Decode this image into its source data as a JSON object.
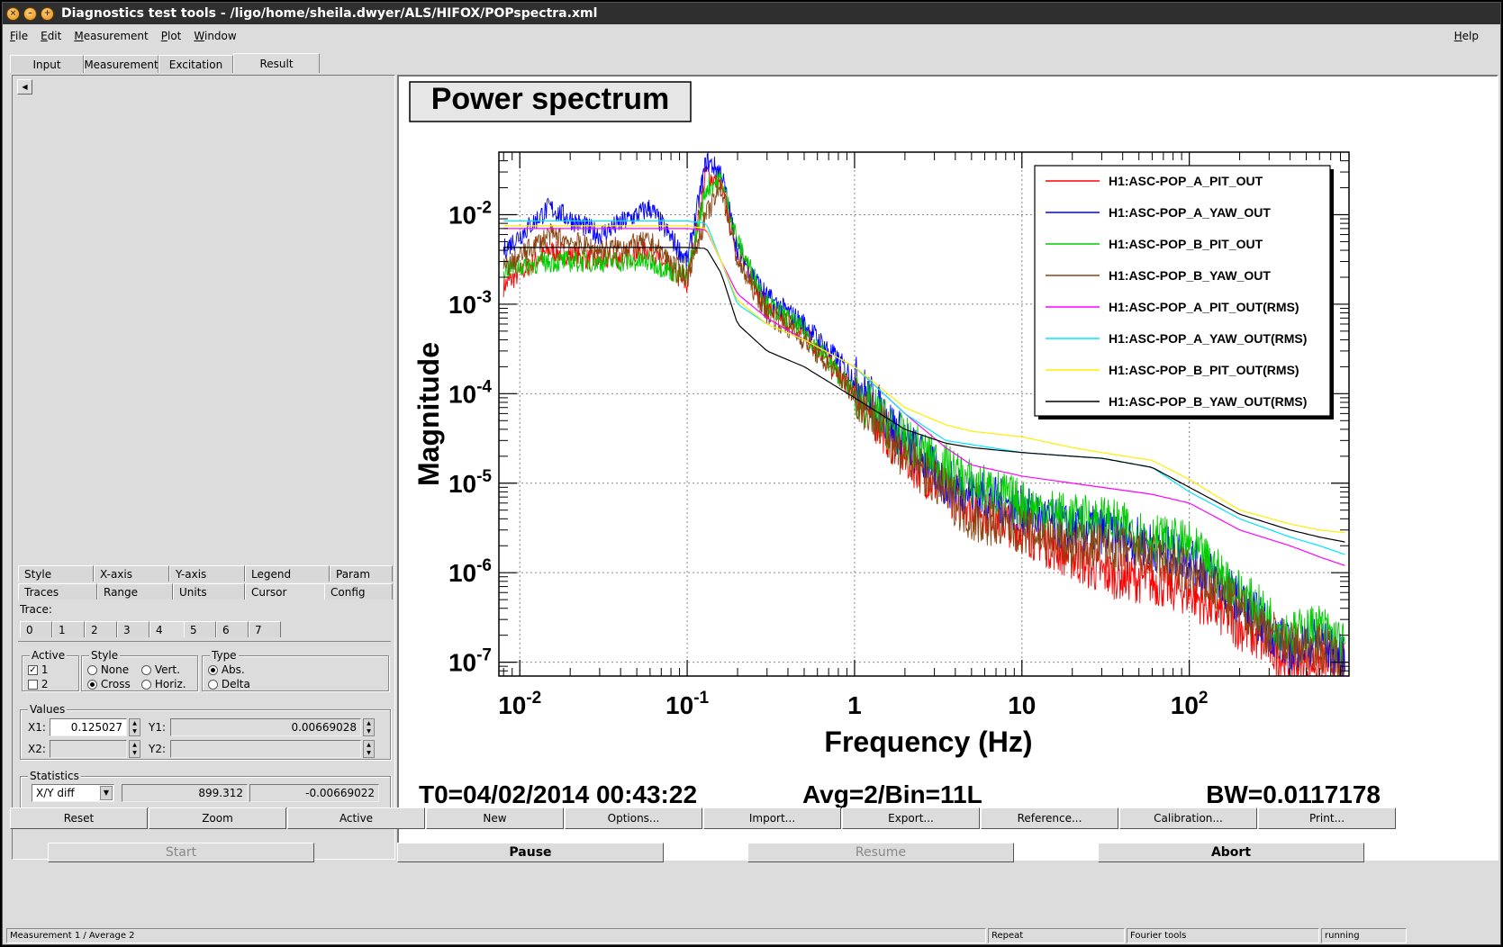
{
  "window": {
    "title": "Diagnostics test tools - /ligo/home/sheila.dwyer/ALS/HIFOX/POPspectra.xml",
    "buttons": [
      "close-icon",
      "minimize-icon",
      "maximize-icon"
    ]
  },
  "menubar": {
    "items": [
      "File",
      "Edit",
      "Measurement",
      "Plot",
      "Window"
    ],
    "help": "Help"
  },
  "top_tabs": [
    "Input",
    "Measurement",
    "Excitation",
    "Result"
  ],
  "top_tabs_active": "Result",
  "options_panel": {
    "tabs_row1": [
      "Style",
      "X-axis",
      "Y-axis",
      "Legend",
      "Param"
    ],
    "tabs_row2": [
      "Traces",
      "Range",
      "Units",
      "Cursor",
      "Config"
    ],
    "active_tab": "Cursor",
    "trace_label": "Trace:",
    "trace_tabs": [
      "0",
      "1",
      "2",
      "3",
      "4",
      "5",
      "6",
      "7"
    ],
    "active_trace": "4",
    "active_group": {
      "title": "Active",
      "items": [
        "1",
        "2"
      ],
      "checked": [
        "1"
      ]
    },
    "style_group": {
      "title": "Style",
      "items": [
        "None",
        "Vert.",
        "Cross",
        "Horiz."
      ],
      "selected": "Cross"
    },
    "type_group": {
      "title": "Type",
      "items": [
        "Abs.",
        "Delta"
      ],
      "selected": "Abs."
    },
    "values": {
      "title": "Values",
      "x1_label": "X1:",
      "x1": "0.125027",
      "y1_label": "Y1:",
      "y1": "0.00669028",
      "x2_label": "X2:",
      "x2": "",
      "y2_label": "Y2:",
      "y2": ""
    },
    "statistics": {
      "title": "Statistics",
      "mode": "X/Y diff",
      "x_value": "899.312",
      "y_value": "-0.00669022"
    }
  },
  "plot": {
    "title": "Power spectrum",
    "footer_t0": "T0=04/02/2014 00:43:22",
    "footer_avg": "Avg=2/Bin=11L",
    "footer_bw": "BW=0.0117178"
  },
  "chart_data": {
    "type": "line",
    "title": "Power spectrum",
    "xlabel": "Frequency (Hz)",
    "ylabel": "Magnitude",
    "xscale": "log",
    "yscale": "log",
    "xlim": [
      0.0075,
      900
    ],
    "ylim": [
      7e-08,
      0.05
    ],
    "x_ticks": [
      "10-2",
      "10-1",
      "1",
      "10",
      "102"
    ],
    "y_ticks": [
      "10-7",
      "10-6",
      "10-5",
      "10-4",
      "10-3",
      "10-2"
    ],
    "grid": true,
    "legend_position": "top-right",
    "x": [
      0.008,
      0.015,
      0.03,
      0.06,
      0.1,
      0.13,
      0.16,
      0.2,
      0.3,
      0.5,
      1,
      2,
      3.5,
      5,
      10,
      20,
      30,
      60,
      100,
      200,
      400,
      600,
      850
    ],
    "series": [
      {
        "name": "H1:ASC-POP_A_PIT_OUT",
        "color": "#ff0000",
        "values": [
          0.0016,
          0.004,
          0.003,
          0.004,
          0.0016,
          0.03,
          0.02,
          0.004,
          0.0009,
          0.0005,
          0.0001,
          2e-05,
          8e-06,
          6e-06,
          3e-06,
          1.5e-06,
          1e-06,
          8e-07,
          6e-07,
          2.5e-07,
          1e-07,
          1e-07,
          9e-08
        ]
      },
      {
        "name": "H1:ASC-POP_A_YAW_OUT",
        "color": "#0000ff",
        "values": [
          0.004,
          0.012,
          0.006,
          0.012,
          0.003,
          0.04,
          0.03,
          0.004,
          0.0012,
          0.0006,
          0.00015,
          3e-05,
          1e-05,
          8e-06,
          5e-06,
          3e-06,
          3e-06,
          2e-06,
          1.5e-06,
          5e-07,
          1.4e-07,
          1.8e-07,
          1e-07
        ]
      },
      {
        "name": "H1:ASC-POP_B_PIT_OUT",
        "color": "#00cc00",
        "values": [
          0.0025,
          0.003,
          0.003,
          0.003,
          0.002,
          0.02,
          0.025,
          0.005,
          0.001,
          0.0005,
          0.0001,
          3e-05,
          1.5e-05,
          1e-05,
          6e-06,
          4e-06,
          4e-06,
          2.5e-06,
          2e-06,
          6e-07,
          2e-07,
          2.5e-07,
          1.5e-07
        ]
      },
      {
        "name": "H1:ASC-POP_B_YAW_OUT",
        "color": "#8b4513",
        "values": [
          0.0025,
          0.006,
          0.004,
          0.005,
          0.002,
          0.01,
          0.02,
          0.003,
          0.0008,
          0.0004,
          0.0001,
          2e-05,
          8e-06,
          4e-06,
          3e-06,
          2e-06,
          2e-06,
          1.5e-06,
          1e-06,
          4e-07,
          1.5e-07,
          1.5e-07,
          1e-07
        ]
      },
      {
        "name": "H1:ASC-POP_A_PIT_OUT(RMS)",
        "color": "#ff00ff",
        "values": [
          0.007,
          0.007,
          0.007,
          0.007,
          0.007,
          0.0068,
          0.003,
          0.0013,
          0.0007,
          0.0004,
          0.0002,
          6e-05,
          2.5e-05,
          1.6e-05,
          1.2e-05,
          1e-05,
          9e-06,
          7.5e-06,
          6e-06,
          3e-06,
          2e-06,
          1.5e-06,
          1.2e-06
        ]
      },
      {
        "name": "H1:ASC-POP_A_YAW_OUT(RMS)",
        "color": "#00e5ff",
        "values": [
          0.0085,
          0.0085,
          0.0085,
          0.0085,
          0.0085,
          0.008,
          0.003,
          0.001,
          0.0006,
          0.0004,
          0.0002,
          6e-05,
          3e-05,
          2.7e-05,
          2.2e-05,
          2e-05,
          1.9e-05,
          1.5e-05,
          8e-06,
          4e-06,
          2.5e-06,
          2e-06,
          1.6e-06
        ]
      },
      {
        "name": "H1:ASC-POP_B_PIT_OUT(RMS)",
        "color": "#ffee00",
        "values": [
          0.0075,
          0.0075,
          0.0075,
          0.0075,
          0.0075,
          0.007,
          0.003,
          0.0011,
          0.0006,
          0.0004,
          0.0002,
          7e-05,
          4.5e-05,
          3.8e-05,
          3.3e-05,
          2.5e-05,
          2.2e-05,
          1.8e-05,
          1.1e-05,
          5e-06,
          3.5e-06,
          3e-06,
          2.8e-06
        ]
      },
      {
        "name": "H1:ASC-POP_B_YAW_OUT(RMS)",
        "color": "#000000",
        "values": [
          0.0043,
          0.0043,
          0.0043,
          0.0043,
          0.0043,
          0.0042,
          0.0022,
          0.0006,
          0.0003,
          0.0002,
          9e-05,
          4e-05,
          2.8e-05,
          2.5e-05,
          2.2e-05,
          2e-05,
          1.9e-05,
          1.5e-05,
          9e-06,
          4.5e-06,
          3e-06,
          2.5e-06,
          2.2e-06
        ]
      }
    ]
  },
  "plot_buttons": [
    "Reset",
    "Zoom",
    "Active",
    "New",
    "Options...",
    "Import...",
    "Export...",
    "Reference...",
    "Calibration...",
    "Print..."
  ],
  "control_buttons": [
    {
      "label": "Start",
      "enabled": false
    },
    {
      "label": "Pause",
      "enabled": true
    },
    {
      "label": "Resume",
      "enabled": false
    },
    {
      "label": "Abort",
      "enabled": true
    }
  ],
  "status": {
    "left": "Measurement 1 / Average 2",
    "repeat": "Repeat",
    "tools": "Fourier tools",
    "state": "running"
  }
}
